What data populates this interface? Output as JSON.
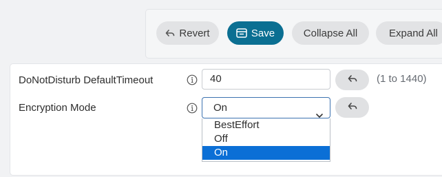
{
  "toolbar": {
    "revert_label": "Revert",
    "save_label": "Save",
    "collapse_label": "Collapse All",
    "expand_label": "Expand All"
  },
  "settings": [
    {
      "label": "DoNotDisturb DefaultTimeout",
      "value": "40",
      "range": "(1 to 1440)"
    },
    {
      "label": "Encryption Mode",
      "selected": "On",
      "options": [
        "BestEffort",
        "Off",
        "On"
      ]
    }
  ],
  "colors": {
    "primary": "#0b6f92",
    "selected_option": "#0b6fd6",
    "pill_grey": "#e2e3e5",
    "focus_border": "#3c72b0"
  },
  "icons": {
    "revert": "undo-arrow-icon",
    "save": "save-tray-icon",
    "info": "info-circle-icon",
    "reset": "undo-arrow-icon",
    "dropdown": "chevron-down-icon"
  }
}
